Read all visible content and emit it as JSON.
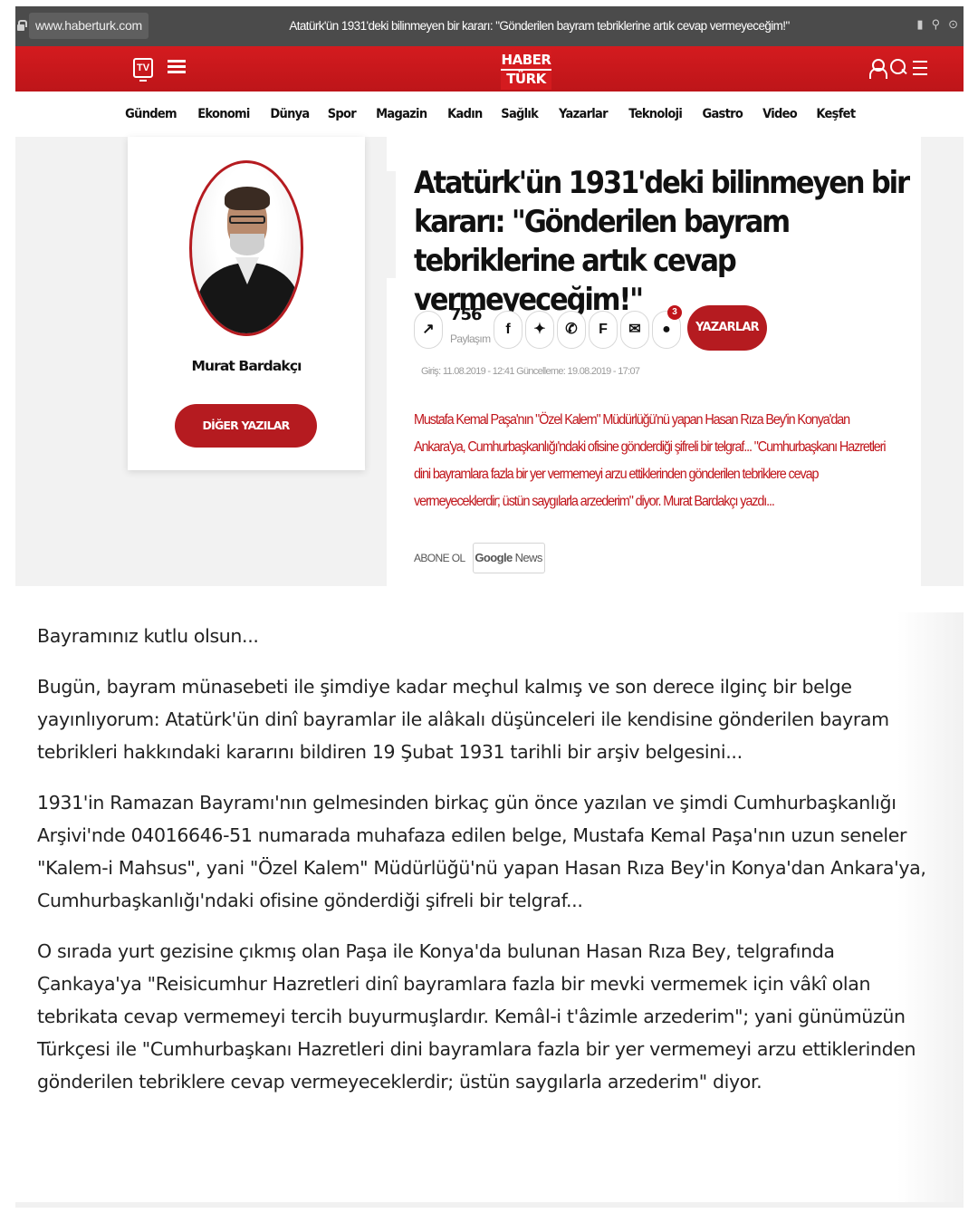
{
  "browser": {
    "url": "www.haberturk.com",
    "title": "Atatürk'ün 1931'deki bilinmeyen bir kararı: \"Gönderilen bayram tebriklerine artık cevap vermeyeceğim!\""
  },
  "header": {
    "logo_line1": "HABER",
    "logo_line2": "TÜRK",
    "tv_label": "TV"
  },
  "nav": {
    "items": [
      "Gündem",
      "Ekonomi",
      "Dünya",
      "Spor",
      "Magazin",
      "Kadın",
      "Sağlık",
      "Yazarlar",
      "Teknoloji",
      "Gastro",
      "Video",
      "Keşfet"
    ]
  },
  "author": {
    "name": "Murat Bardakçı",
    "other_button": "DİĞER YAZILAR"
  },
  "article": {
    "headline": "Atatürk'ün 1931'deki bilinmeyen bir kararı: \"Gönderilen bayram tebriklerine artık cevap vermeyeceğim!\"",
    "share_count": "756",
    "share_label": "Paylaşım",
    "comment_badge": "3",
    "writers_button": "YAZARLAR",
    "dates": "Giriş: 11.08.2019 - 12:41 Güncelleme: 19.08.2019 - 17:07",
    "summary": "Mustafa Kemal Paşa'nın \"Özel Kalem\" Müdürlüğü'nü yapan Hasan Rıza Bey'in Konya'dan Ankara'ya, Cumhurbaşkanlığı'ndaki ofisine gönderdiği şifreli bir telgraf... \"Cumhurbaşkanı Hazretleri dini bayramlara fazla bir yer vermemeyi arzu ettiklerinden gönderilen tebriklere cevap vermeyeceklerdir; üstün saygılarla arzederim\" diyor. Murat Bardakçı yazdı...",
    "subscribe_label": "ABONE OL",
    "google_news_g": "Google",
    "google_news_n": "News"
  },
  "body": {
    "paragraphs": [
      "Bayramınız kutlu olsun...",
      "Bugün, bayram münasebeti ile şimdiye kadar meçhul kalmış ve son derece ilginç bir belge yayınlıyorum: Atatürk'ün dinî bayramlar ile alâkalı düşünceleri ile kendisine gönderilen bayram tebrikleri hakkındaki kararını bildiren 19 Şubat 1931 tarihli bir arşiv belgesini...",
      "1931'in Ramazan Bayramı'nın gelmesinden birkaç gün önce yazılan ve şimdi Cumhurbaşkanlığı Arşivi'nde 04016646-51 numarada muhafaza edilen belge, Mustafa Kemal Paşa'nın uzun seneler \"Kalem-i Mahsus\", yani \"Özel Kalem\" Müdürlüğü'nü yapan Hasan Rıza Bey'in Konya'dan Ankara'ya, Cumhurbaşkanlığı'ndaki ofisine gönderdiği şifreli bir telgraf...",
      "O sırada yurt gezisine çıkmış olan Paşa ile Konya'da bulunan Hasan Rıza Bey, telgrafında Çankaya'ya \"Reisicumhur Hazretleri dinî bayramlara fazla bir mevki vermemek için vâkî olan tebrikata cevap vermemeyi tercih buyurmuşlardır. Kemâl-i t'âzimle arzederim\"; yani günümüzün Türkçesi ile \"Cumhurbaşkanı Hazretleri dini bayramlara fazla bir yer vermemeyi arzu ettiklerinden gönderilen tebriklere cevap vermeyeceklerdir; üstün saygılarla arzederim\" diyor."
    ]
  },
  "colors": {
    "brand_red": "#d41b1f",
    "button_red": "#b51b20",
    "summary_red": "#c0141a"
  },
  "icons": [
    "lock-icon",
    "tv-icon",
    "newspaper-icon",
    "user-icon",
    "search-icon",
    "menu-icon",
    "share-icon",
    "facebook-icon",
    "twitter-icon",
    "whatsapp-icon",
    "flipboard-icon",
    "mail-icon",
    "comment-icon"
  ]
}
